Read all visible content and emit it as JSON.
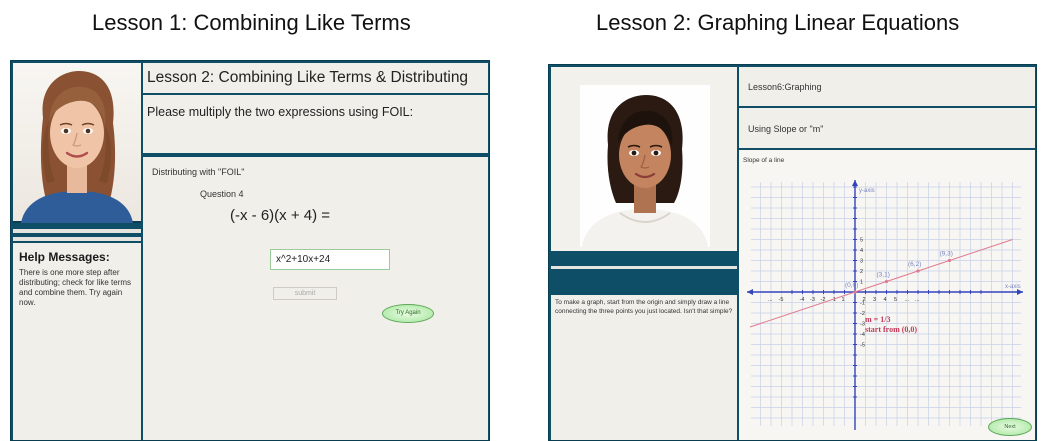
{
  "captions": {
    "left": "Lesson 1: Combining Like Terms",
    "right": "Lesson 2: Graphing Linear Equations"
  },
  "lesson1": {
    "title": "Lesson 2: Combining Like Terms & Distributing",
    "prompt": "Please multiply the two expressions using FOIL:",
    "section": "Distributing with \"FOIL\"",
    "question_label": "Question 4",
    "equation": "(-x - 6)(x + 4) =",
    "answer_value": "x^2+10x+24",
    "submit_label": "submit",
    "try_again_label": "Try Again",
    "help_title": "Help Messages:",
    "help_text": "There is one more step after distributing; check for like terms and combine them. Try again now.",
    "colors": {
      "frame": "#0e4e66",
      "panel": "#f1efea",
      "button_green": "#b8ecb0"
    },
    "avatar": "female-avatar-brown-hair"
  },
  "lesson2": {
    "title": "Lesson6:Graphing",
    "subtitle": "Using Slope or \"m\"",
    "graph_label": "Slope of a line",
    "instructions": "To make a graph, start from the origin and simply draw a line connecting the three points you just located. Isn't that simple?",
    "next_label": "Next",
    "avatar": "female-avatar-dark-hair",
    "graph": {
      "y_axis_label": "y-axis",
      "x_axis_label": "x-axis",
      "points": [
        {
          "label": "(0,0)",
          "x": 0,
          "y": 0
        },
        {
          "label": "(3,1)",
          "x": 3,
          "y": 1
        },
        {
          "label": "(6,2)",
          "x": 6,
          "y": 2
        },
        {
          "label": "(9,3)",
          "x": 9,
          "y": 3
        }
      ],
      "slope_text": "m = 1/3",
      "start_text": "start from (0,0)",
      "x_tick_labels": [
        "...",
        "-5",
        "-4",
        "-3",
        "-2",
        "-1",
        "1",
        "2",
        "3",
        "4",
        "5",
        "...",
        "..."
      ],
      "y_tick_labels": [
        "5",
        "4",
        "3",
        "2",
        "1",
        "-1",
        "-2",
        "-3",
        "-4",
        "-5"
      ],
      "colors": {
        "grid": "#c8d0ea",
        "axis": "#3344bb",
        "line": "#e07a8e",
        "labels": "#7a86c4",
        "annot": "#c0395a"
      }
    }
  }
}
